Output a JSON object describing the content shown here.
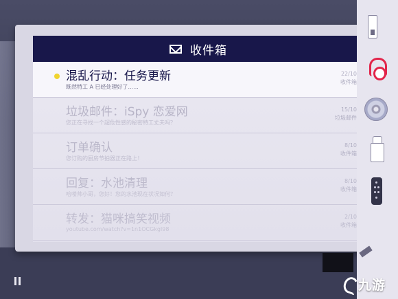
{
  "inbox": {
    "title": "收件箱",
    "icon": "mail-icon"
  },
  "emails": [
    {
      "subject": "混乱行动：任务更新",
      "preview": "既然特工 A 已经处理好了......",
      "date": "22/10",
      "folder": "收件箱",
      "unread": true
    },
    {
      "subject": "垃圾邮件：iSpy 恋爱网",
      "preview": "您正在寻找一个超危性感的秘密特工丈夫吗？",
      "date": "15/10",
      "folder": "垃圾邮件",
      "unread": false
    },
    {
      "subject": "订单确认",
      "preview": "您订购的厨房节拍器正在路上！",
      "date": "8/10",
      "folder": "收件箱",
      "unread": false
    },
    {
      "subject": "回复：水池清理",
      "preview": "哈喽帅小哥，您好！您的水池现在状况如何？",
      "date": "8/10",
      "folder": "收件箱",
      "unread": false
    },
    {
      "subject": "转发：猫咪搞笑视频",
      "preview": "youtube.com/watch?v=1n1OCGkgl98",
      "date": "2/10",
      "folder": "收件箱",
      "unread": false
    }
  ],
  "sidebar": {
    "items": [
      "usb-icon",
      "headphones-icon",
      "disc-icon",
      "robot-icon",
      "remote-icon"
    ]
  },
  "hud": {
    "pause_icon": "pause-icon"
  },
  "watermark": {
    "text": "九游"
  },
  "colors": {
    "header_bg": "#18174a",
    "unread_dot": "#f0d430",
    "headphones": "#e2254a"
  }
}
